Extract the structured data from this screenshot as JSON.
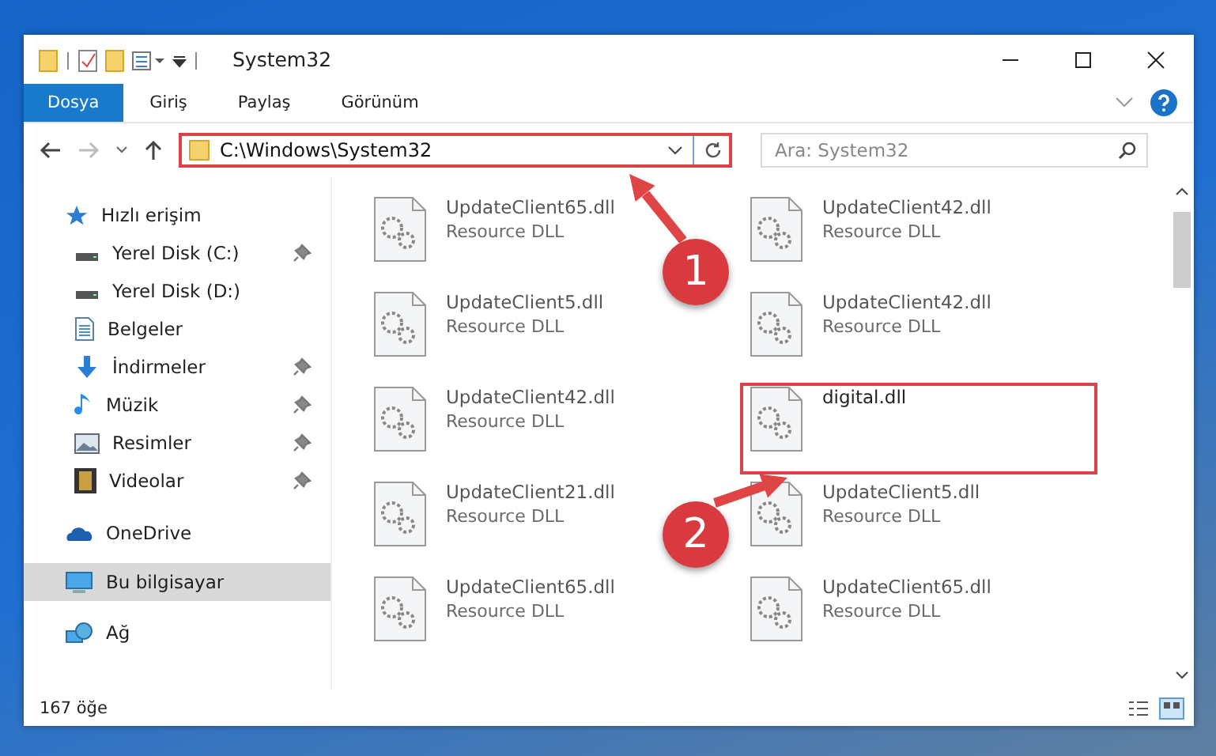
{
  "window": {
    "title": "System32"
  },
  "ribbon": {
    "tabs": [
      {
        "label": "Dosya",
        "selected": true
      },
      {
        "label": "Giriş",
        "selected": false
      },
      {
        "label": "Paylaş",
        "selected": false
      },
      {
        "label": "Görünüm",
        "selected": false
      }
    ]
  },
  "address": {
    "path": "C:\\Windows\\System32",
    "highlighted": true
  },
  "search": {
    "placeholder": "Ara: System32"
  },
  "sidebar": {
    "items": [
      {
        "label": "Hızlı erişim",
        "kind": "star",
        "selected": false,
        "children": [
          {
            "label": "Yerel Disk (C:)",
            "kind": "drive",
            "pinned": true,
            "selected": false
          },
          {
            "label": "Yerel Disk (D:)",
            "kind": "drive",
            "pinned": false,
            "selected": false
          },
          {
            "label": "Belgeler",
            "kind": "document",
            "pinned": false,
            "selected": false
          },
          {
            "label": "İndirmeler",
            "kind": "download",
            "pinned": true,
            "selected": false
          },
          {
            "label": "Müzik",
            "kind": "music",
            "pinned": true,
            "selected": false
          },
          {
            "label": "Resimler",
            "kind": "picture",
            "pinned": true,
            "selected": false
          },
          {
            "label": "Videolar",
            "kind": "video",
            "pinned": true,
            "selected": false
          }
        ]
      },
      {
        "label": "OneDrive",
        "kind": "cloud",
        "selected": false
      },
      {
        "label": "Bu bilgisayar",
        "kind": "computer",
        "selected": true
      },
      {
        "label": "Ağ",
        "kind": "network",
        "selected": false
      }
    ]
  },
  "files": [
    {
      "name": "UpdateClient65.dll",
      "type": "Resource DLL",
      "highlighted": false
    },
    {
      "name": "UpdateClient42.dll",
      "type": "Resource DLL",
      "highlighted": false
    },
    {
      "name": "UpdateClient5.dll",
      "type": "Resource DLL",
      "highlighted": false
    },
    {
      "name": "UpdateClient42.dll",
      "type": "Resource DLL",
      "highlighted": false
    },
    {
      "name": "UpdateClient42.dll",
      "type": "Resource DLL",
      "highlighted": false
    },
    {
      "name": "digital.dll",
      "highlighted": true
    },
    {
      "name": "UpdateClient21.dll",
      "type": "Resource DLL",
      "highlighted": false
    },
    {
      "name": "UpdateClient5.dll",
      "type": "Resource DLL",
      "highlighted": false
    },
    {
      "name": "UpdateClient65.dll",
      "type": "Resource DLL",
      "highlighted": false
    },
    {
      "name": "UpdateClient65.dll",
      "type": "Resource DLL",
      "highlighted": false
    }
  ],
  "status_bar": {
    "count": "167 öğe"
  },
  "annotations": [
    {
      "number": "1"
    },
    {
      "number": "2"
    }
  ]
}
